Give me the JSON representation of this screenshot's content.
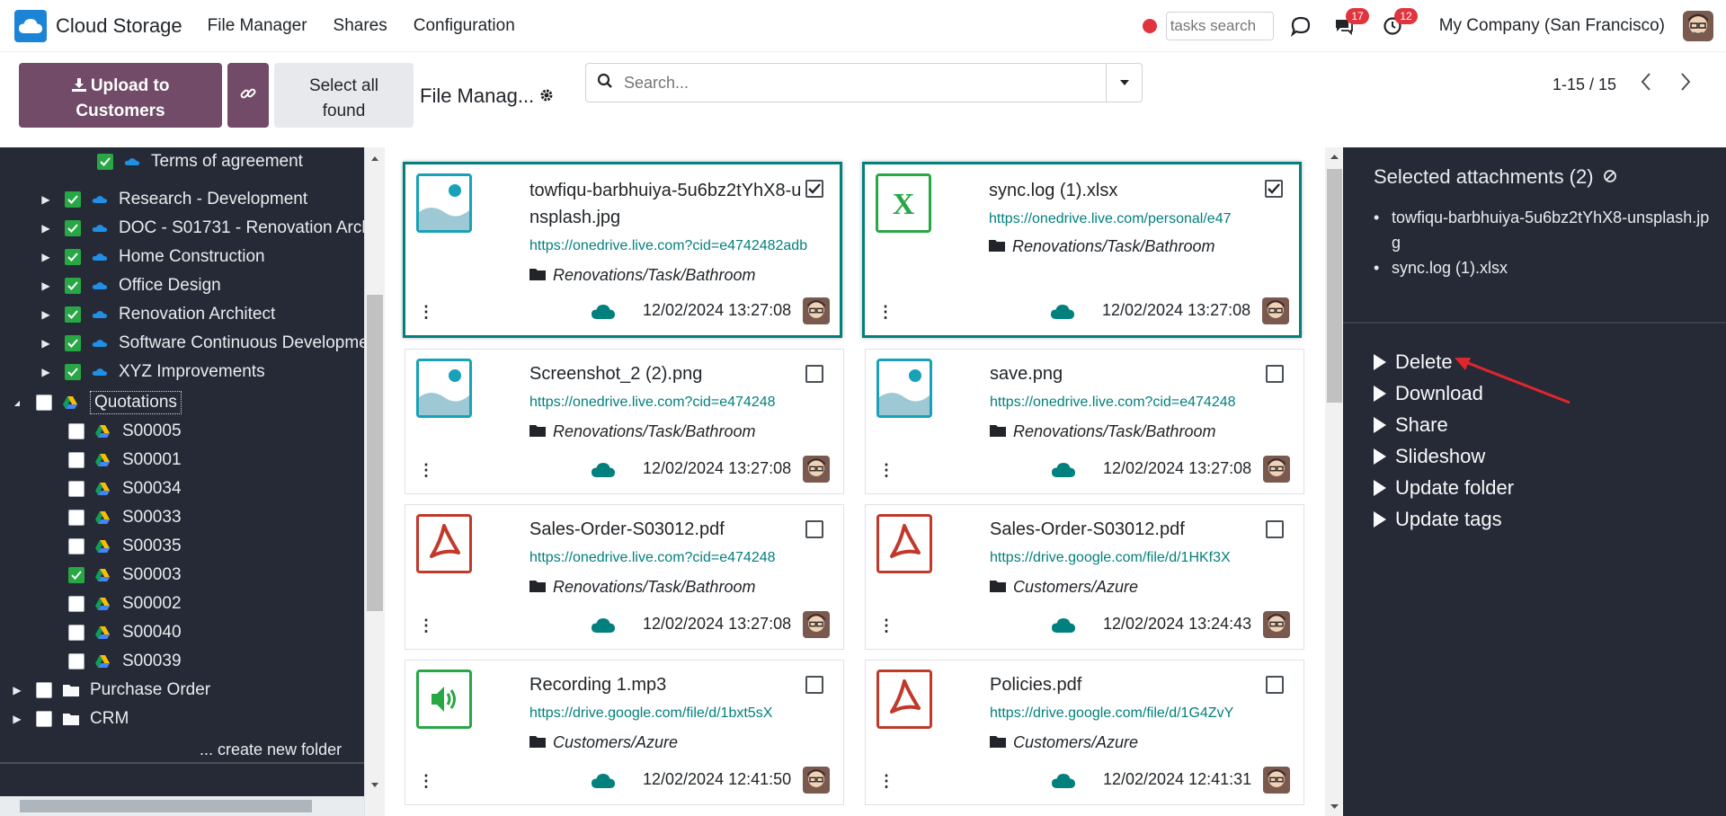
{
  "navbar": {
    "app_name": "Cloud Storage",
    "menu": [
      "File Manager",
      "Shares",
      "Configuration"
    ],
    "tasks_search_placeholder": "tasks search",
    "chat_badge": "17",
    "activity_badge": "12",
    "company": "My Company (San Francisco)"
  },
  "control": {
    "upload_label_line1": "Upload to",
    "upload_label_line2": "Customers",
    "select_all_line1": "Select all",
    "select_all_line2": "found",
    "breadcrumb": "File Manag...",
    "search_placeholder": "Search...",
    "pager": "1-15 / 15"
  },
  "sidebar": {
    "items": [
      {
        "label": "Terms of agreement",
        "checked": true,
        "icon": "onedrive-icon"
      },
      {
        "label": "Research - Development",
        "checked": true,
        "icon": "onedrive-icon"
      },
      {
        "label": "DOC - S01731 - Renovation Arch",
        "checked": true,
        "icon": "onedrive-icon"
      },
      {
        "label": "Home Construction",
        "checked": true,
        "icon": "onedrive-icon"
      },
      {
        "label": "Office Design",
        "checked": true,
        "icon": "onedrive-icon"
      },
      {
        "label": "Renovation Architect",
        "checked": true,
        "icon": "onedrive-icon"
      },
      {
        "label": "Software Continuous Developme",
        "checked": true,
        "icon": "onedrive-icon"
      },
      {
        "label": "XYZ Improvements",
        "checked": true,
        "icon": "onedrive-icon"
      },
      {
        "label": "Quotations",
        "checked": false,
        "icon": "google-drive-icon"
      },
      {
        "label": "S00005",
        "checked": false,
        "icon": "google-drive-icon"
      },
      {
        "label": "S00001",
        "checked": false,
        "icon": "google-drive-icon"
      },
      {
        "label": "S00034",
        "checked": false,
        "icon": "google-drive-icon"
      },
      {
        "label": "S00033",
        "checked": false,
        "icon": "google-drive-icon"
      },
      {
        "label": "S00035",
        "checked": false,
        "icon": "google-drive-icon"
      },
      {
        "label": "S00003",
        "checked": true,
        "icon": "google-drive-icon"
      },
      {
        "label": "S00002",
        "checked": false,
        "icon": "google-drive-icon"
      },
      {
        "label": "S00040",
        "checked": false,
        "icon": "google-drive-icon"
      },
      {
        "label": "S00039",
        "checked": false,
        "icon": "google-drive-icon"
      },
      {
        "label": "Purchase Order",
        "checked": false,
        "icon": "folder-icon"
      },
      {
        "label": "CRM",
        "checked": false,
        "icon": "folder-icon"
      }
    ],
    "create_folder": "... create new folder"
  },
  "cards": [
    {
      "title": "towfiqu-barbhuiya-5u6bz2tYhX8-unsplash.jpg",
      "url": "https://onedrive.live.com?cid=e4742482adb",
      "folder": "Renovations/Task/Bathroom",
      "date": "12/02/2024 13:27:08",
      "selected": true,
      "type": "image"
    },
    {
      "title": "sync.log (1).xlsx",
      "url": "https://onedrive.live.com/personal/e47",
      "folder": "Renovations/Task/Bathroom",
      "date": "12/02/2024 13:27:08",
      "selected": true,
      "type": "excel"
    },
    {
      "title": "Screenshot_2 (2).png",
      "url": "https://onedrive.live.com?cid=e474248",
      "folder": "Renovations/Task/Bathroom",
      "date": "12/02/2024 13:27:08",
      "selected": false,
      "type": "image"
    },
    {
      "title": "save.png",
      "url": "https://onedrive.live.com?cid=e474248",
      "folder": "Renovations/Task/Bathroom",
      "date": "12/02/2024 13:27:08",
      "selected": false,
      "type": "image"
    },
    {
      "title": "Sales-Order-S03012.pdf",
      "url": "https://onedrive.live.com?cid=e474248",
      "folder": "Renovations/Task/Bathroom",
      "date": "12/02/2024 13:27:08",
      "selected": false,
      "type": "pdf"
    },
    {
      "title": "Sales-Order-S03012.pdf",
      "url": "https://drive.google.com/file/d/1HKf3X",
      "folder": "Customers/Azure",
      "date": "12/02/2024 13:24:43",
      "selected": false,
      "type": "pdf"
    },
    {
      "title": "Recording 1.mp3",
      "url": "https://drive.google.com/file/d/1bxt5sX",
      "folder": "Customers/Azure",
      "date": "12/02/2024 12:41:50",
      "selected": false,
      "type": "audio"
    },
    {
      "title": "Policies.pdf",
      "url": "https://drive.google.com/file/d/1G4ZvY",
      "folder": "Customers/Azure",
      "date": "12/02/2024 12:41:31",
      "selected": false,
      "type": "pdf"
    }
  ],
  "rpanel": {
    "title": "Selected attachments (2)",
    "selected": [
      "towfiqu-barbhuiya-5u6bz2tYhX8-unsplash.jpg",
      "sync.log (1).xlsx"
    ],
    "actions": [
      "Delete",
      "Download",
      "Share",
      "Slideshow",
      "Update folder",
      "Update tags"
    ]
  },
  "colors": {
    "primary": "#714b67",
    "teal": "#01807d",
    "dark_panel": "#262a36",
    "check_green": "#28a745",
    "badge_red": "#e0343e",
    "annotation_red": "#e0262d"
  }
}
